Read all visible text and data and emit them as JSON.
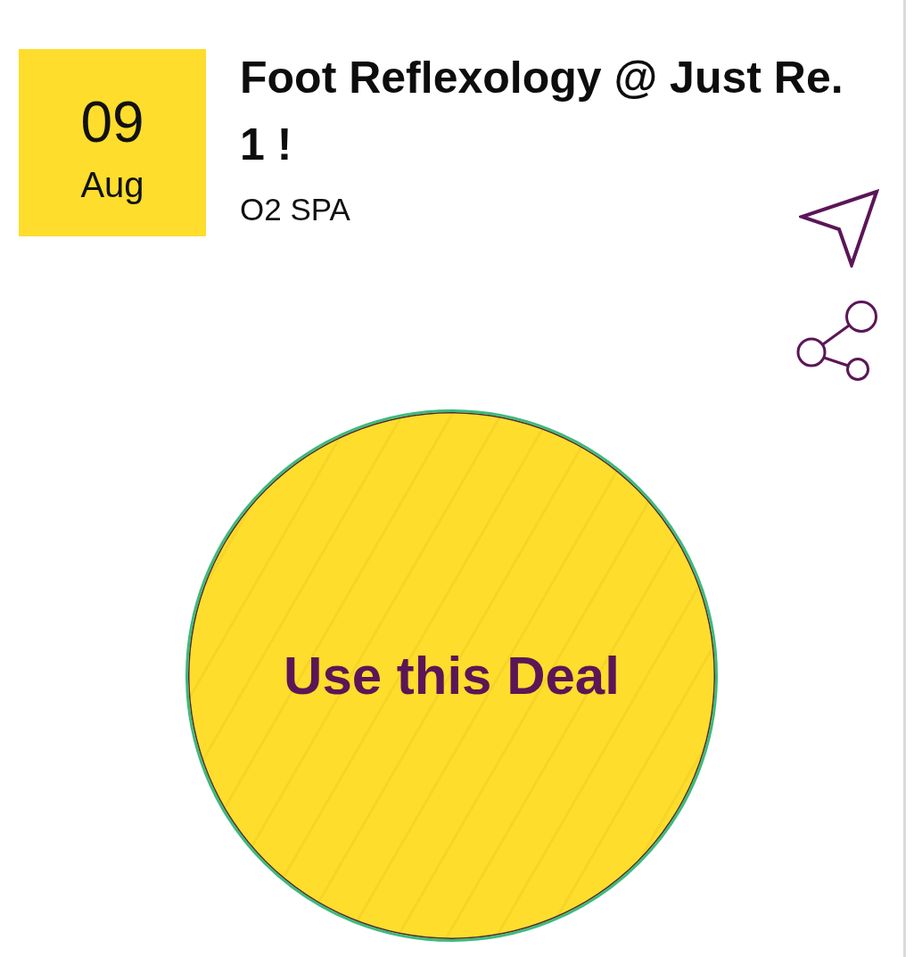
{
  "date": {
    "day": "09",
    "month": "Aug"
  },
  "deal": {
    "title": "Foot Reflexology @ Just Re. 1 !",
    "merchant": "O2 SPA"
  },
  "actions": [
    {
      "kind": "directions"
    },
    {
      "kind": "share"
    }
  ],
  "cta": {
    "label": "Use this Deal"
  }
}
